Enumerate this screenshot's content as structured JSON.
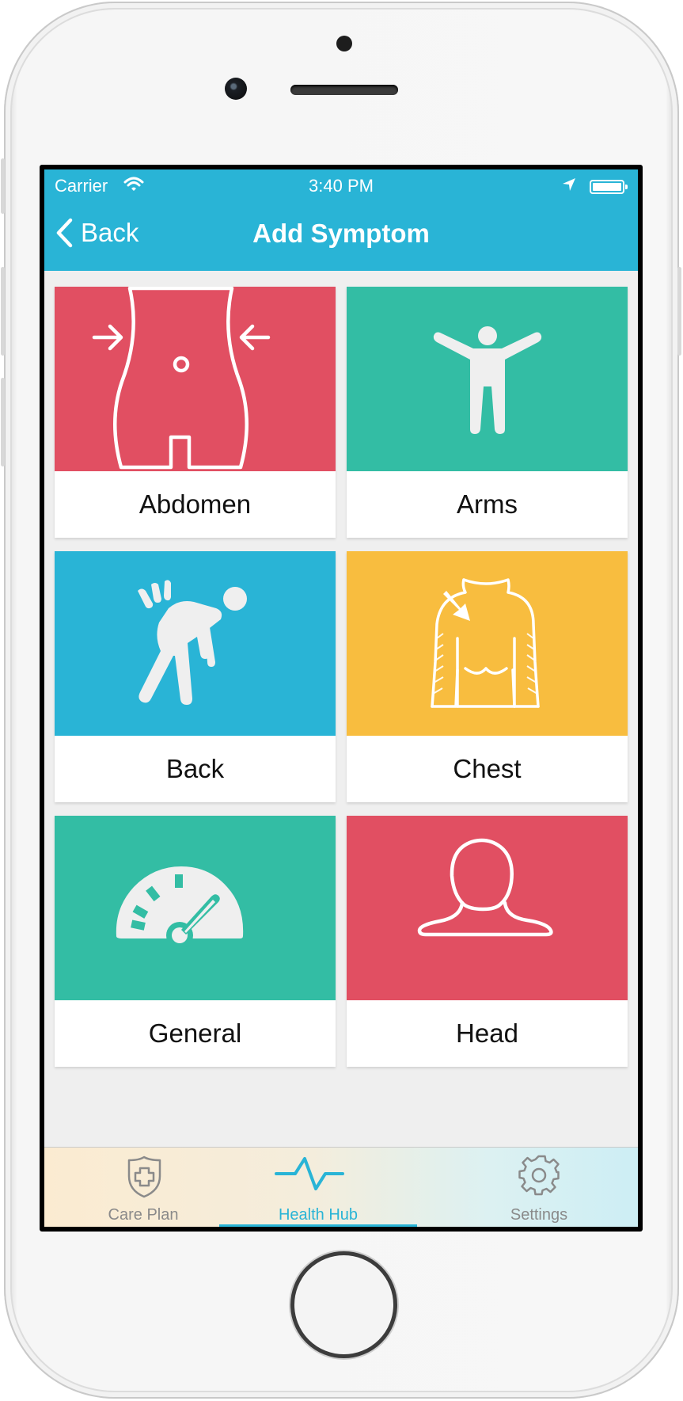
{
  "status_bar": {
    "carrier": "Carrier",
    "time": "3:40 PM",
    "wifi_icon": "wifi-icon",
    "location_icon": "location-arrow-icon",
    "battery_icon": "battery-full-icon"
  },
  "nav": {
    "back_label": "Back",
    "title": "Add Symptom",
    "color": "#29b4d6"
  },
  "symptoms": [
    {
      "label": "Abdomen",
      "icon": "abdomen-icon",
      "color": "#e14f62"
    },
    {
      "label": "Arms",
      "icon": "arms-person-icon",
      "color": "#33bda4"
    },
    {
      "label": "Back",
      "icon": "back-pain-icon",
      "color": "#29b4d6"
    },
    {
      "label": "Chest",
      "icon": "chest-torso-icon",
      "color": "#f8bd3f"
    },
    {
      "label": "General",
      "icon": "gauge-icon",
      "color": "#33bda4"
    },
    {
      "label": "Head",
      "icon": "head-icon",
      "color": "#e14f62"
    }
  ],
  "tabs": [
    {
      "label": "Care Plan",
      "icon": "shield-cross-icon",
      "active": false
    },
    {
      "label": "Health Hub",
      "icon": "heartbeat-icon",
      "active": true
    },
    {
      "label": "Settings",
      "icon": "gear-icon",
      "active": false
    }
  ]
}
